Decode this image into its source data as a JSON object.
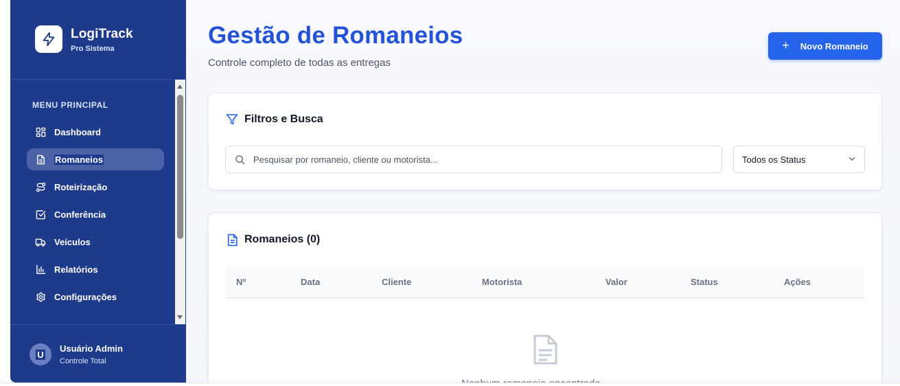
{
  "brand": {
    "name": "LogiTrack",
    "subtitle": "Pro Sistema"
  },
  "sidebar": {
    "section_title": "MENU PRINCIPAL",
    "items": [
      {
        "label": "Dashboard",
        "icon": "dashboard-icon"
      },
      {
        "label": "Romaneios",
        "icon": "document-icon",
        "active": true
      },
      {
        "label": "Roteirização",
        "icon": "route-icon"
      },
      {
        "label": "Conferência",
        "icon": "checkbox-icon"
      },
      {
        "label": "Veículos",
        "icon": "truck-icon"
      },
      {
        "label": "Relatórios",
        "icon": "bar-chart-icon"
      },
      {
        "label": "Configurações",
        "icon": "gear-icon"
      }
    ]
  },
  "user": {
    "initial": "U",
    "name": "Usuário Admin",
    "role": "Controle Total"
  },
  "header": {
    "title": "Gestão de Romaneios",
    "subtitle": "Controle completo de todas as entregas",
    "new_button_label": "Novo Romaneio"
  },
  "filters": {
    "title": "Filtros e Busca",
    "search_placeholder": "Pesquisar por romaneio, cliente ou motorista...",
    "status_value": "Todos os Status"
  },
  "table": {
    "title": "Romaneios (0)",
    "columns": [
      "Nº",
      "Data",
      "Cliente",
      "Motorista",
      "Valor",
      "Status",
      "Ações"
    ],
    "empty_text": "Nenhum romaneio encontrado"
  },
  "colors": {
    "sidebar": "#1e3a8a",
    "accent": "#2563eb",
    "title": "#2553d6"
  }
}
